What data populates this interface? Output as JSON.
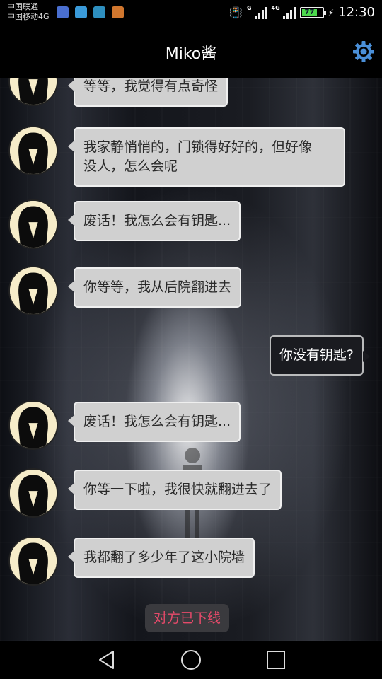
{
  "status_bar": {
    "carrier_1": "中国联通",
    "carrier_2": "中国移动4G",
    "net_g": "G",
    "net_4g": "4G",
    "battery": "77",
    "battery_percent": 77,
    "time": "12:30",
    "notification_icons": [
      "qq-icon",
      "message-icon",
      "gallery-icon",
      "weibo-icon"
    ]
  },
  "header": {
    "title": "Miko酱",
    "settings_icon": "gear-icon",
    "accent_color": "#4a8fd8"
  },
  "messages": [
    {
      "side": "in",
      "text": "等等，我觉得有点奇怪"
    },
    {
      "side": "in",
      "text": "我家静悄悄的，门锁得好好的，但好像\n没人，怎么会呢"
    },
    {
      "side": "in",
      "text": "废话！我怎么会有钥匙..."
    },
    {
      "side": "in",
      "text": "你等等，我从后院翻进去"
    },
    {
      "side": "out",
      "text": "你没有钥匙?"
    },
    {
      "side": "in",
      "text": "废话！我怎么会有钥匙..."
    },
    {
      "side": "in",
      "text": "你等一下啦，我很快就翻进去了"
    },
    {
      "side": "in",
      "text": "我都翻了多少年了这小院墙"
    }
  ],
  "offline_notice": "对方已下线",
  "nav": {
    "back": "back-triangle-icon",
    "home": "home-circle-icon",
    "recents": "recents-square-icon"
  }
}
